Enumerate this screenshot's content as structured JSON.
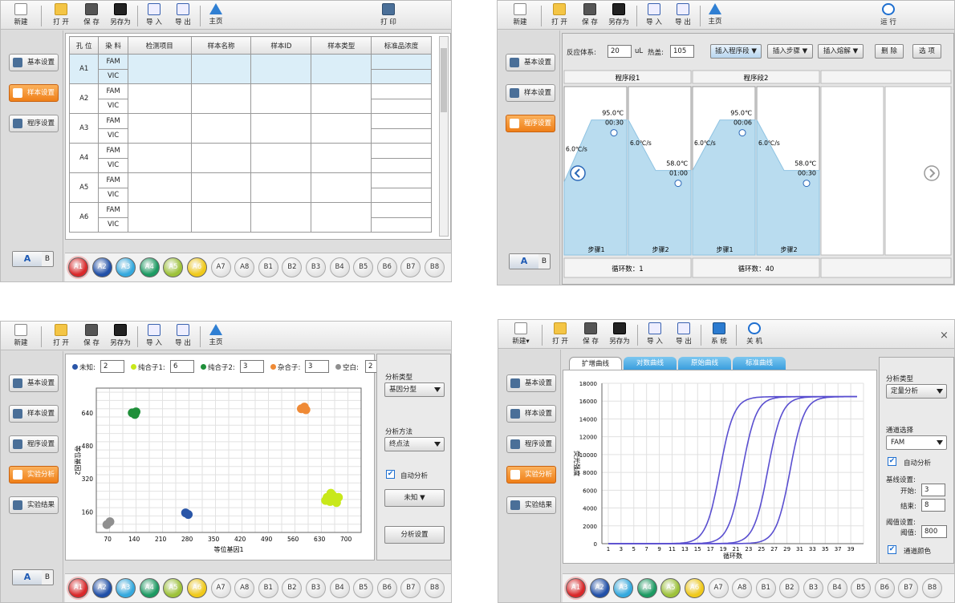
{
  "toolbar": {
    "new": "新建",
    "new2": "新建",
    "open": "打 开",
    "save": "保 存",
    "saveas": "另存为",
    "import": "导 入",
    "export": "导 出",
    "home": "主页",
    "print": "打 印",
    "run": "运 行",
    "system": "系 统",
    "shutdown": "关 机"
  },
  "sidebar": {
    "basic": "基本设置",
    "sample": "样本设置",
    "program": "程序设置",
    "analysis": "实验分析",
    "results": "实验结果"
  },
  "ab": {
    "a": "A",
    "b": "B"
  },
  "wells": [
    {
      "label": "A1",
      "color": "#d9282a"
    },
    {
      "label": "A2",
      "color": "#2150a8"
    },
    {
      "label": "A3",
      "color": "#35a9de"
    },
    {
      "label": "A4",
      "color": "#1c9a62"
    },
    {
      "label": "A5",
      "color": "#9dc23a"
    },
    {
      "label": "A6",
      "color": "#f0c91a"
    },
    {
      "label": "A7",
      "color": ""
    },
    {
      "label": "A8",
      "color": ""
    },
    {
      "label": "B1",
      "color": ""
    },
    {
      "label": "B2",
      "color": ""
    },
    {
      "label": "B3",
      "color": ""
    },
    {
      "label": "B4",
      "color": ""
    },
    {
      "label": "B5",
      "color": ""
    },
    {
      "label": "B6",
      "color": ""
    },
    {
      "label": "B7",
      "color": ""
    },
    {
      "label": "B8",
      "color": ""
    }
  ],
  "sample_table": {
    "headers": [
      "孔 位",
      "染 料",
      "检测项目",
      "样本名称",
      "样本ID",
      "样本类型",
      "标准品浓度"
    ],
    "rows": [
      {
        "well": "A1",
        "dyes": [
          "FAM",
          "VIC"
        ]
      },
      {
        "well": "A2",
        "dyes": [
          "FAM",
          "VIC"
        ]
      },
      {
        "well": "A3",
        "dyes": [
          "FAM",
          "VIC"
        ]
      },
      {
        "well": "A4",
        "dyes": [
          "FAM",
          "VIC"
        ]
      },
      {
        "well": "A5",
        "dyes": [
          "FAM",
          "VIC"
        ]
      },
      {
        "well": "A6",
        "dyes": [
          "FAM",
          "VIC"
        ]
      }
    ]
  },
  "program": {
    "volume_label": "反应体系:",
    "volume": "20",
    "unit": "uL",
    "lid_label": "热盖:",
    "lid": "105",
    "insert_segment": "插入程序段",
    "insert_step": "插入步骤",
    "insert_melt": "插入熔解",
    "delete": "删 除",
    "options": "选 项",
    "segments": [
      {
        "title": "程序段1",
        "cycles": "循环数：1",
        "steps": [
          {
            "temp": "95.0℃",
            "time": "00:30",
            "rate": "6.0℃/s",
            "label": "步骤1",
            "level": 0.88
          },
          {
            "temp": "58.0℃",
            "time": "01:00",
            "rate": "6.0℃/s",
            "label": "步骤2",
            "level": 0.53
          }
        ]
      },
      {
        "title": "程序段2",
        "cycles": "循环数：40",
        "steps": [
          {
            "temp": "95.0℃",
            "time": "00:06",
            "rate": "6.0℃/s",
            "label": "步骤1",
            "level": 0.88
          },
          {
            "temp": "58.0℃",
            "time": "00:30",
            "rate": "6.0℃/s",
            "label": "步骤2",
            "level": 0.53
          }
        ]
      }
    ]
  },
  "genotype": {
    "legend": [
      {
        "name": "未知:",
        "value": "2",
        "color": "#2a56a8"
      },
      {
        "name": "纯合子1:",
        "value": "6",
        "color": "#c8e81a"
      },
      {
        "name": "纯合子2:",
        "value": "3",
        "color": "#1f8f3a"
      },
      {
        "name": "杂合子:",
        "value": "3",
        "color": "#ef8a36"
      },
      {
        "name": "空白:",
        "value": "2",
        "color": "#8f8f8f"
      }
    ],
    "analysis_type_label": "分析类型",
    "analysis_type": "基因分型",
    "method_label": "分析方法",
    "method": "终点法",
    "auto_label": "自动分析",
    "unknown": "未知",
    "settings": "分析设置"
  },
  "quant": {
    "tabs": [
      "扩增曲线",
      "对数曲线",
      "原始曲线",
      "标准曲线"
    ],
    "analysis_type_label": "分析类型",
    "analysis_type": "定量分析",
    "channel_label": "通道选择",
    "channel": "FAM",
    "auto_label": "自动分析",
    "baseline_label": "基线设置:",
    "start_label": "开始:",
    "start": "3",
    "end_label": "结束:",
    "end": "8",
    "threshold_label": "阈值设置:",
    "threshold_value_label": "阈值:",
    "threshold": "800",
    "channel_color_label": "通道颜色",
    "close": "×"
  },
  "chart_data": [
    {
      "type": "scatter",
      "xlabel": "等位基因1",
      "ylabel": "等位基因2",
      "xlim": [
        40,
        740
      ],
      "ylim": [
        60,
        760
      ],
      "xticks": [
        "70",
        "140",
        "210",
        "280",
        "350",
        "420",
        "490",
        "560",
        "630",
        "700"
      ],
      "yticks": [
        "160",
        "320",
        "480",
        "640"
      ],
      "series": [
        {
          "name": "未知",
          "color": "#2a56a8",
          "points": [
            [
              276,
              155
            ],
            [
              283,
              147
            ]
          ]
        },
        {
          "name": "纯合子1",
          "color": "#c8e81a",
          "points": [
            [
              650,
              230
            ],
            [
              665,
              240
            ],
            [
              672,
              220
            ],
            [
              658,
              210
            ],
            [
              680,
              230
            ],
            [
              646,
              215
            ],
            [
              660,
              250
            ],
            [
              675,
              205
            ]
          ]
        },
        {
          "name": "纯合子2",
          "color": "#1f8f3a",
          "points": [
            [
              135,
              640
            ],
            [
              145,
              645
            ],
            [
              142,
              632
            ]
          ]
        },
        {
          "name": "杂合子",
          "color": "#ef8a36",
          "points": [
            [
              582,
              660
            ],
            [
              590,
              668
            ],
            [
              594,
              655
            ]
          ]
        },
        {
          "name": "空白",
          "color": "#8f8f8f",
          "points": [
            [
              68,
              98
            ],
            [
              76,
              112
            ]
          ]
        }
      ]
    },
    {
      "type": "line",
      "xlabel": "循环数",
      "ylabel": "荧光强度",
      "xlim": [
        0,
        41
      ],
      "ylim": [
        0,
        18000
      ],
      "xticks": [
        "1",
        "3",
        "5",
        "7",
        "9",
        "11",
        "13",
        "15",
        "17",
        "19",
        "21",
        "23",
        "25",
        "27",
        "29",
        "31",
        "33",
        "35",
        "37",
        "39"
      ],
      "yticks": [
        "0",
        "2000",
        "4000",
        "6000",
        "8000",
        "10000",
        "12000",
        "14000",
        "16000",
        "18000"
      ],
      "series": [
        {
          "name": "",
          "color": "#5a4fd0",
          "midpoints": [
            18.5,
            22,
            26,
            29.5
          ],
          "max": 16500
        }
      ]
    }
  ]
}
